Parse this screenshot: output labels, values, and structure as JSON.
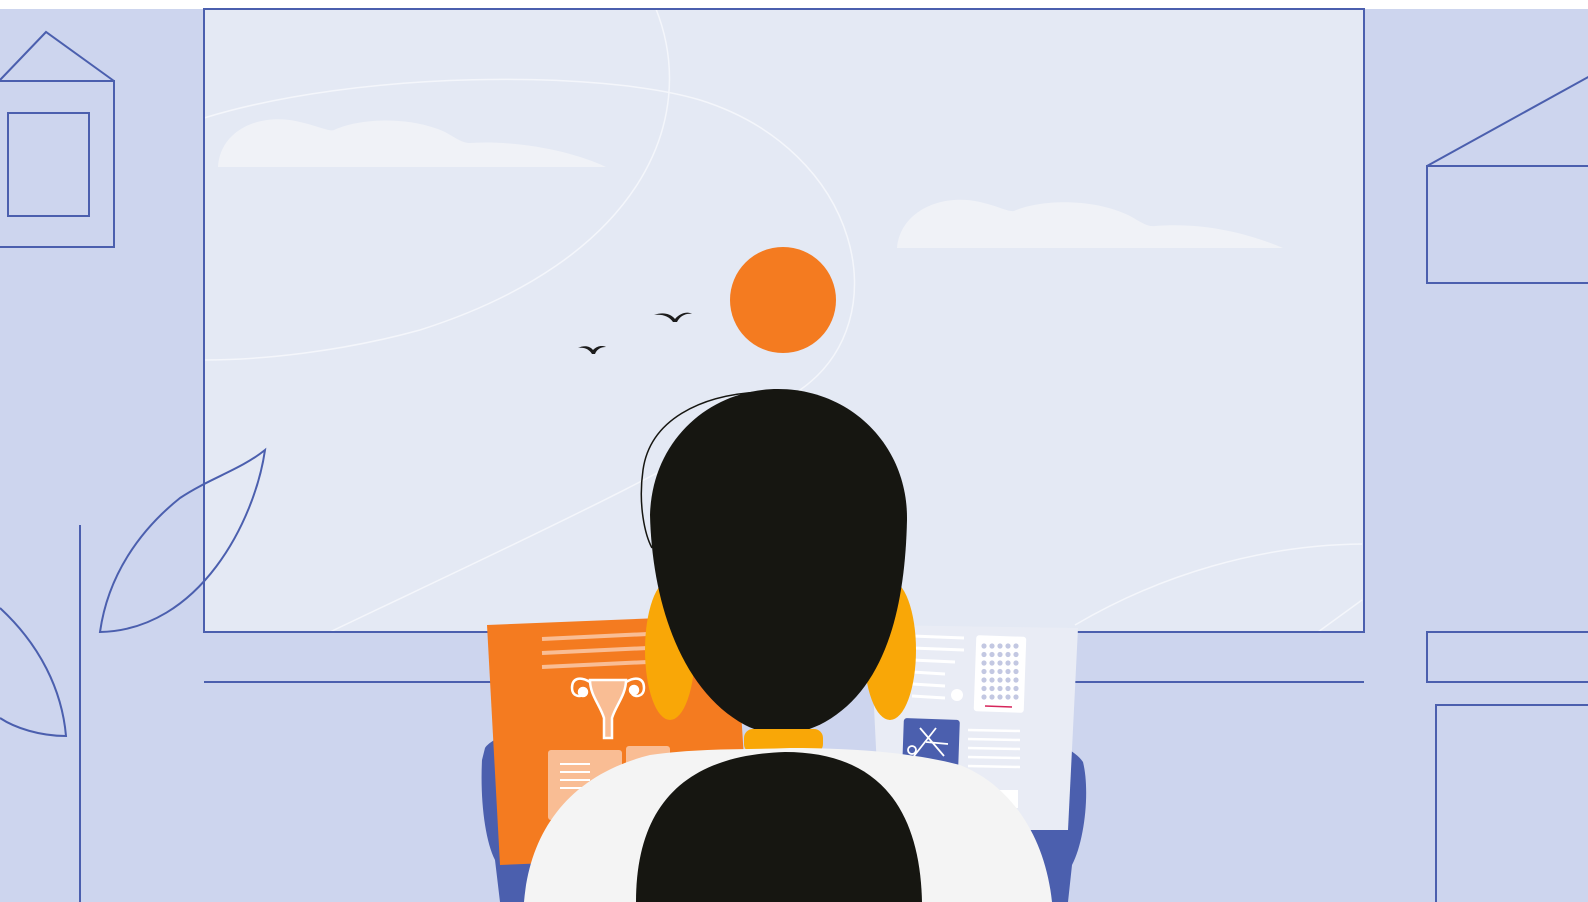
{
  "scene": {
    "description_free": true,
    "colors": {
      "wall": "#cdd5ee",
      "sky": "#e4e9f4",
      "line": "#4b5fae",
      "sun": "#f47b20",
      "cloud": "#f0f2f7",
      "hair": "#161611",
      "earring": "#f9a707",
      "shirt": "#f4f4f4",
      "folder": "#f47b20",
      "folder_light": "#f9bd94",
      "chair": "#4b5fae",
      "paper": "#e9ecf5",
      "dots": "#c3c8e2",
      "bird": "#1c1c1c",
      "accent_red": "#d6255a"
    },
    "icons": [
      "house-outline-icon",
      "leaf-outline-icon",
      "sun-icon",
      "bird-icon",
      "uterus-icon",
      "calendar-icon",
      "test-tubes-icon"
    ]
  }
}
